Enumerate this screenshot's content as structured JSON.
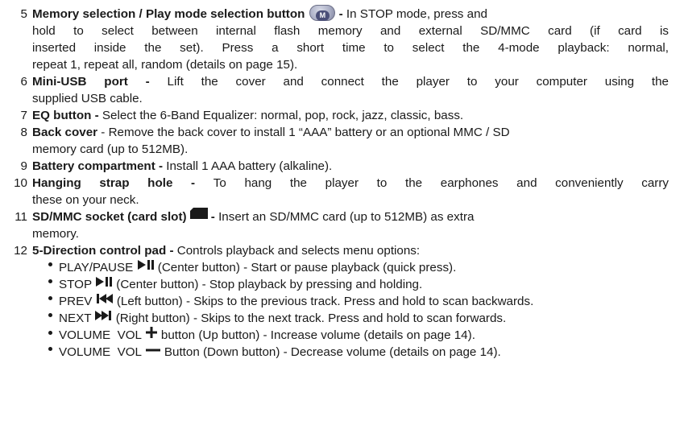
{
  "items": [
    {
      "number": "5",
      "title": "Memory selection / Play mode selection button",
      "button_glyph": "M",
      "sep": " - ",
      "lines": [
        "In STOP mode, press and",
        "hold to select between internal flash memory and external SD/MMC card (if card is",
        "inserted inside the set). Press a short time to select the 4-mode playback: normal,",
        "repeat 1, repeat all, random (details on page 15)."
      ]
    },
    {
      "number": "6",
      "title": "Mini-USB port",
      "sep": " - ",
      "lines": [
        "Lift the cover and connect the player to your computer using the",
        "supplied USB cable."
      ]
    },
    {
      "number": "7",
      "title": "EQ button",
      "sep": " - ",
      "lines": [
        "Select the 6-Band Equalizer: normal, pop, rock, jazz, classic, bass."
      ]
    },
    {
      "number": "8",
      "title": "Back cover",
      "sep": " - ",
      "lines": [
        "Remove the back cover to install 1 “AAA” battery or an optional MMC / SD",
        "memory card (up to 512MB)."
      ]
    },
    {
      "number": "9",
      "title": "Battery compartment",
      "sep": " - ",
      "lines": [
        "Install 1 AAA battery (alkaline)."
      ]
    },
    {
      "number": "10",
      "title": "Hanging strap hole",
      "sep": " - ",
      "lines": [
        "To hang the player to the earphones and conveniently carry",
        "these on your neck."
      ]
    },
    {
      "number": "11",
      "title": "SD/MMC socket (card slot)",
      "sep": " - ",
      "lines": [
        "Insert an SD/MMC card (up to 512MB) as extra",
        "memory."
      ]
    },
    {
      "number": "12",
      "title": "5-Direction control pad",
      "sep": " - ",
      "lines": [
        "Controls playback and selects menu options:"
      ]
    }
  ],
  "bullets": [
    {
      "prefix": "PLAY/PAUSE",
      "icon": "play-pause-icon",
      "text": "(Center button) - Start or pause playback (quick press)."
    },
    {
      "prefix": "STOP",
      "icon": "play-pause-icon",
      "text": "(Center button) - Stop playback by pressing and holding."
    },
    {
      "prefix": "PREV",
      "icon": "previous-track-icon",
      "text": "(Left button) - Skips to the previous track. Press and hold to scan backwards."
    },
    {
      "prefix": "NEXT",
      "icon": "next-track-icon",
      "text": "(Right button) - Skips to the next track. Press and hold to scan forwards."
    },
    {
      "prefix": "VOLUME  VOL",
      "icon": "plus-icon",
      "text": "button (Up button) - Increase volume (details on page 14)."
    },
    {
      "prefix": "VOLUME  VOL",
      "icon": "minus-icon",
      "text": "Button (Down button) - Decrease volume (details on page 14)."
    }
  ],
  "colors": {
    "text": "#1a1a1a",
    "button_fill": "#a9adc4",
    "button_inner": "#4b4f78"
  }
}
